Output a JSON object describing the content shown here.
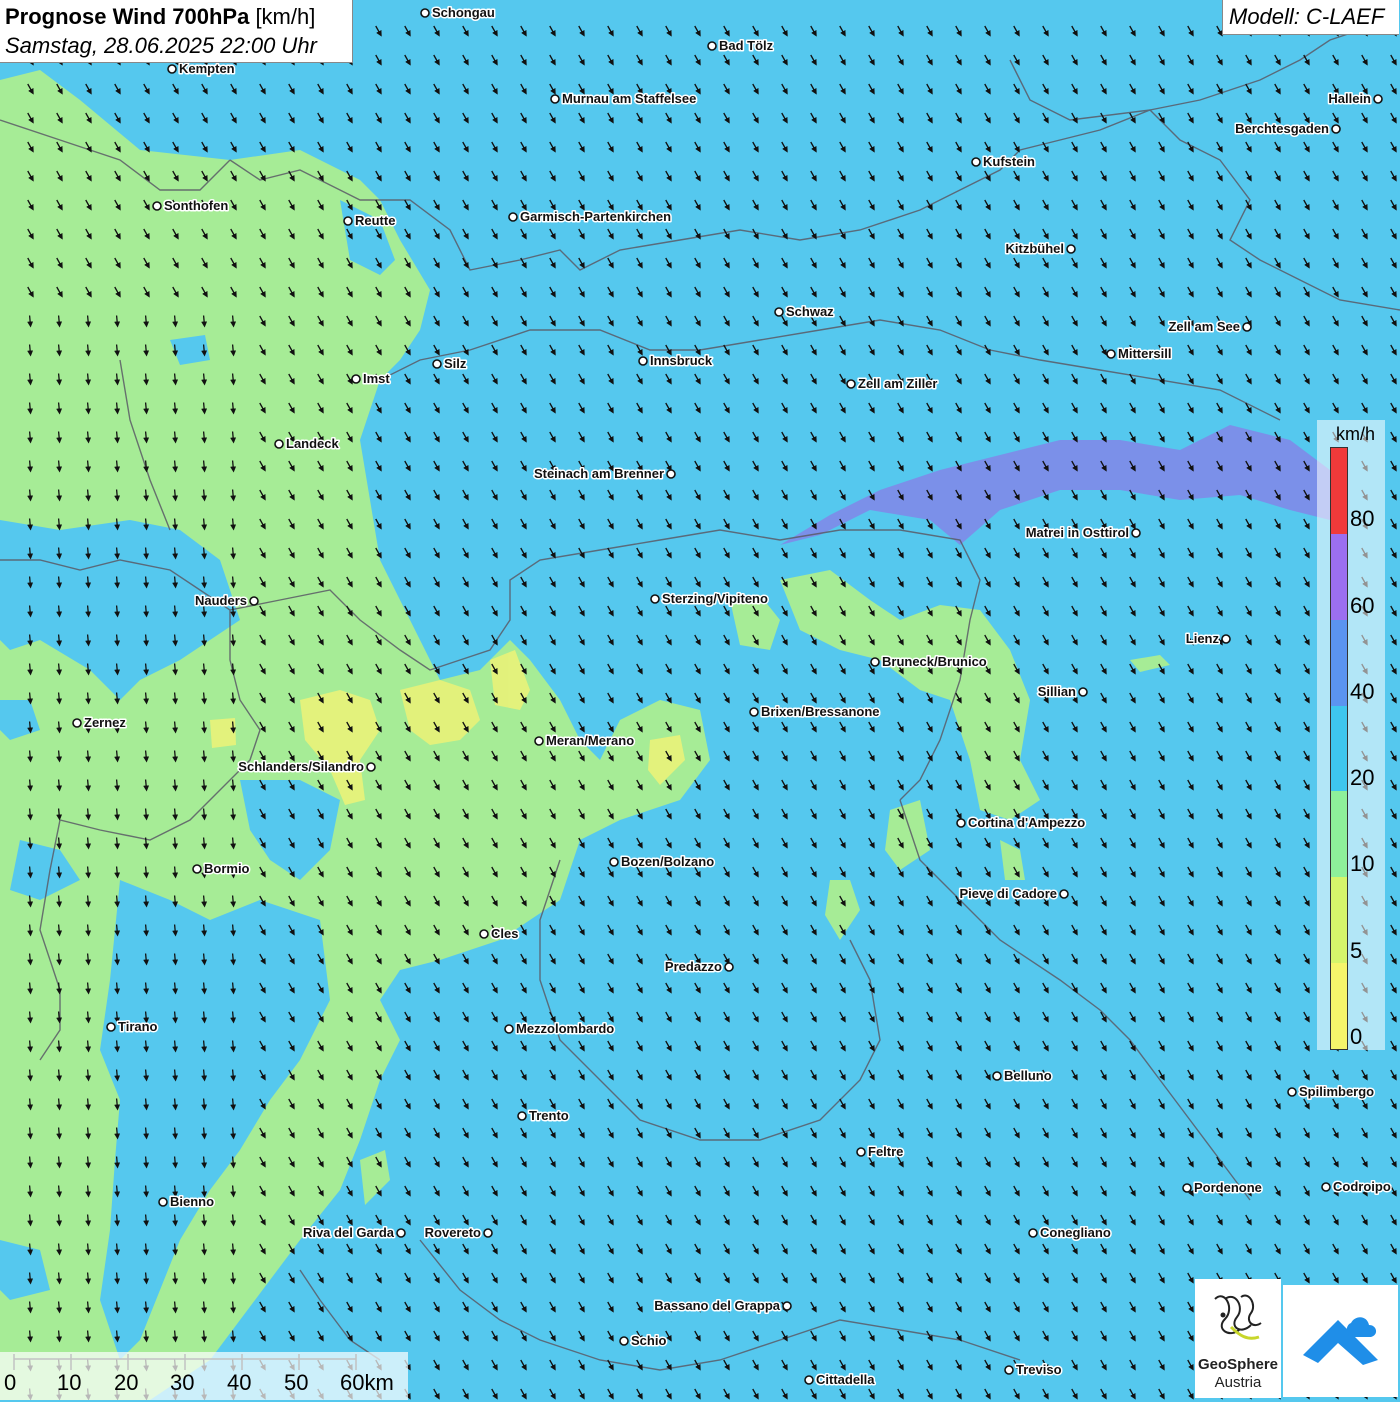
{
  "header": {
    "title_bold": "Prognose Wind 700hPa",
    "title_unit": "[km/h]",
    "datetime": "Samstag, 28.06.2025 22:00 Uhr",
    "model": "Modell: C-LAEF"
  },
  "legend": {
    "unit": "km/h",
    "labels": [
      "80",
      "60",
      "40",
      "20",
      "10",
      "5",
      "0"
    ],
    "colors": [
      "#f03a3a",
      "#9b6ff0",
      "#5b94f0",
      "#3ec6ee",
      "#8ef09a",
      "#d6f56b",
      "#f6f56b"
    ]
  },
  "scale": {
    "labels": [
      "0",
      "10",
      "20",
      "30",
      "40",
      "50",
      "60km"
    ]
  },
  "logo": {
    "name_line1": "GeoSphere",
    "name_line2": "Austria"
  },
  "colors": {
    "wind_0_10_green": "#a6ec96",
    "wind_10_20_blue": "#55c8ee",
    "wind_40_60_purple": "#7f8ae8",
    "wind_5_yellow": "#e6f27a",
    "arrow": "#111111"
  },
  "cities": [
    {
      "name": "Schongau"
    },
    {
      "name": "Bad Tölz"
    },
    {
      "name": "Kempten"
    },
    {
      "name": "Murnau am Staffelsee"
    },
    {
      "name": "Hallein"
    },
    {
      "name": "Berchtesgaden"
    },
    {
      "name": "Kufstein"
    },
    {
      "name": "Sonthofen"
    },
    {
      "name": "Reutte"
    },
    {
      "name": "Garmisch-Partenkirchen"
    },
    {
      "name": "Kitzbühel"
    },
    {
      "name": "Schwaz"
    },
    {
      "name": "Zell am See"
    },
    {
      "name": "Innsbruck"
    },
    {
      "name": "Mittersill"
    },
    {
      "name": "Silz"
    },
    {
      "name": "Imst"
    },
    {
      "name": "Zell am Ziller"
    },
    {
      "name": "Landeck"
    },
    {
      "name": "Steinach am Brenner"
    },
    {
      "name": "Matrei in Osttirol"
    },
    {
      "name": "Nauders"
    },
    {
      "name": "Sterzing/Vipiteno"
    },
    {
      "name": "Lienz"
    },
    {
      "name": "Bruneck/Brunico"
    },
    {
      "name": "Sillian"
    },
    {
      "name": "Zernez"
    },
    {
      "name": "Brixen/Bressanone"
    },
    {
      "name": "Meran/Merano"
    },
    {
      "name": "Schlanders/Silandro"
    },
    {
      "name": "Cortina d'Ampezzo"
    },
    {
      "name": "Bozen/Bolzano"
    },
    {
      "name": "Bormio"
    },
    {
      "name": "Pieve di Cadore"
    },
    {
      "name": "Cles"
    },
    {
      "name": "Predazzo"
    },
    {
      "name": "Tirano"
    },
    {
      "name": "Mezzolombardo"
    },
    {
      "name": "Belluno"
    },
    {
      "name": "Spilimbergo"
    },
    {
      "name": "Trento"
    },
    {
      "name": "Feltre"
    },
    {
      "name": "Pordenone"
    },
    {
      "name": "Codroipo"
    },
    {
      "name": "Bienno"
    },
    {
      "name": "Riva del Garda"
    },
    {
      "name": "Rovereto"
    },
    {
      "name": "Conegliano"
    },
    {
      "name": "Bassano del Grappa"
    },
    {
      "name": "Schio"
    },
    {
      "name": "Treviso"
    },
    {
      "name": "Cittadella"
    }
  ]
}
